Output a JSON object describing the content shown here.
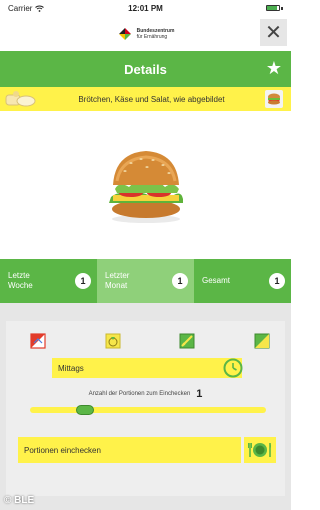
{
  "status": {
    "carrier": "Carrier",
    "time": "12:01 PM",
    "battery_level": 0.85
  },
  "header": {
    "logo_line1": "Bundeszentrum",
    "logo_line2": "für Ernährung",
    "close_icon": "close-icon"
  },
  "title_bar": {
    "title": "Details",
    "favorite_icon": "star-icon"
  },
  "meal": {
    "description": "Brötchen, Käse und Salat, wie abgebildet",
    "category_icon": "food-category-icon",
    "detail_icon": "sandwich-thumbnail-icon"
  },
  "image": {
    "subject": "sandwich-image"
  },
  "stats": [
    {
      "label_line1": "Letzte",
      "label_line2": "Woche",
      "count": "1"
    },
    {
      "label_line1": "Letzter",
      "label_line2": "Monat",
      "count": "1"
    },
    {
      "label_line1": "Gesamt",
      "label_line2": "",
      "count": "1"
    }
  ],
  "day_icons": [
    "day-icon-1",
    "day-icon-2",
    "day-icon-3",
    "day-icon-4"
  ],
  "meal_time": {
    "value": "Mittags",
    "icon": "clock-icon"
  },
  "portions": {
    "label": "Anzahl der Portionen zum Einchecken",
    "value": "1",
    "fraction": 0.12
  },
  "checkin": {
    "label": "Portionen einchecken",
    "icon": "plate-cutlery-icon"
  },
  "watermark": "© BLE",
  "colors": {
    "green": "#5bb646",
    "light_green": "#8fd07a",
    "yellow": "#fff24a",
    "panel": "#e6e6e6"
  }
}
